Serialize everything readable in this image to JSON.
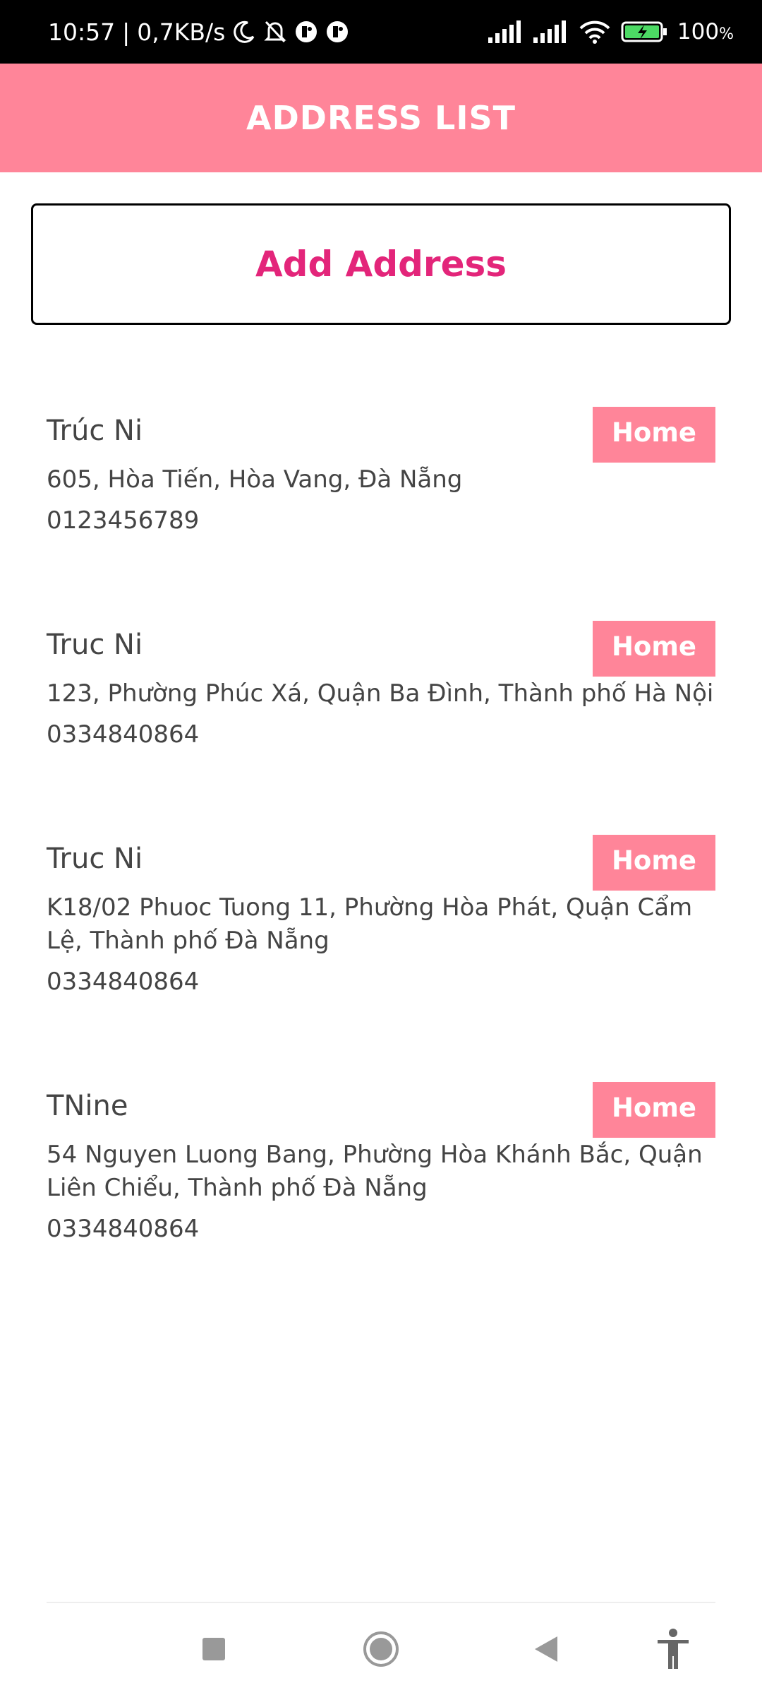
{
  "status_bar": {
    "time": "10:57",
    "separator": "|",
    "speed": "0,7KB/s",
    "battery": "100",
    "battery_unit": "%",
    "icons": [
      "moon-icon",
      "bell-off-icon",
      "app-notification-icon",
      "app-notification-icon",
      "signal-icon",
      "signal-icon",
      "wifi-icon",
      "battery-charging-icon"
    ]
  },
  "header": {
    "title": "ADDRESS LIST"
  },
  "add_button": {
    "label": "Add Address"
  },
  "addresses": [
    {
      "name": "Trúc Ni",
      "tag": "Home",
      "address": "605, Hòa Tiến, Hòa Vang, Đà Nẵng",
      "phone": "0123456789"
    },
    {
      "name": "Truc Ni",
      "tag": "Home",
      "address": "123, Phường Phúc Xá, Quận Ba Đình, Thành phố Hà Nội",
      "phone": "0334840864"
    },
    {
      "name": "Truc Ni",
      "tag": "Home",
      "address": "K18/02 Phuoc Tuong 11, Phường Hòa Phát, Quận Cẩm Lệ, Thành phố Đà Nẵng",
      "phone": "0334840864"
    },
    {
      "name": "TNine",
      "tag": "Home",
      "address": "54 Nguyen Luong Bang, Phường Hòa Khánh Bắc, Quận Liên Chiểu, Thành phố Đà Nẵng",
      "phone": "0334840864"
    }
  ],
  "nav": {
    "icons": [
      "square-recents-icon",
      "circle-home-icon",
      "triangle-back-icon",
      "accessibility-icon"
    ]
  },
  "colors": {
    "accent": "#ff8599",
    "add_text": "#e3257a",
    "body_text": "#444444"
  }
}
